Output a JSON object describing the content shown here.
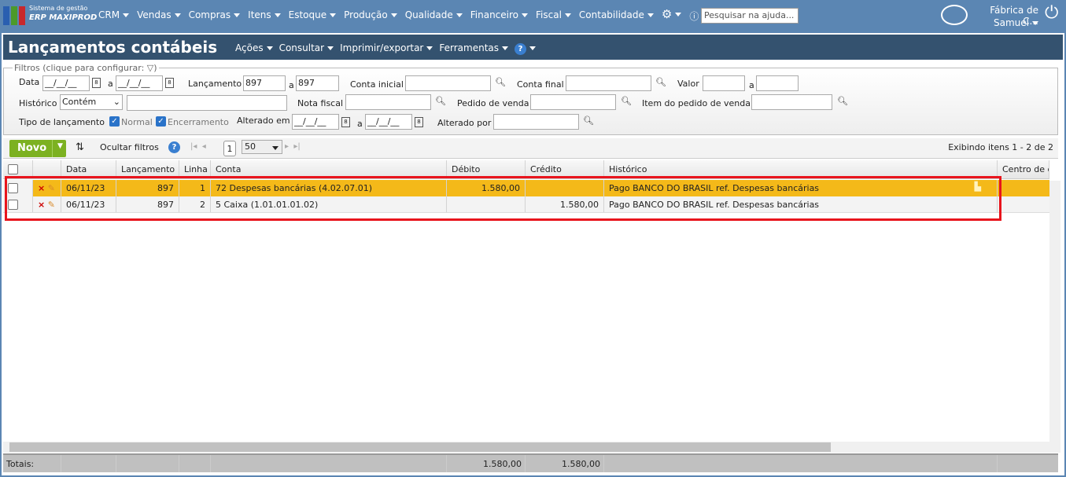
{
  "topbar": {
    "brand_line1": "Sistema de gestão",
    "brand_line2": "ERP MAXIPROD",
    "menu": [
      "CRM",
      "Vendas",
      "Compras",
      "Itens",
      "Estoque",
      "Produção",
      "Qualidade",
      "Financeiro",
      "Fiscal",
      "Contabilidade"
    ],
    "search_placeholder": "Pesquisar na ajuda...",
    "company": "Fábrica de C...",
    "user": "Samuel"
  },
  "page": {
    "title": "Lançamentos contábeis",
    "menu": [
      "Ações",
      "Consultar",
      "Imprimir/exportar",
      "Ferramentas"
    ]
  },
  "filters": {
    "legend": "Filtros (clique para configurar:",
    "legend_end": ")",
    "data_label": "Data",
    "date_placeholder": "__/__/__",
    "a": "a",
    "lancamento_label": "Lançamento",
    "lancamento_from": "897",
    "lancamento_to": "897",
    "conta_inicial_label": "Conta inicial",
    "conta_final_label": "Conta final",
    "valor_label": "Valor",
    "historico_label": "Histórico",
    "historico_op": "Contém",
    "nota_fiscal_label": "Nota fiscal",
    "pedido_label": "Pedido de venda",
    "item_pedido_label": "Item do pedido de venda",
    "tipo_label": "Tipo de lançamento",
    "normal": "Normal",
    "encerramento": "Encerramento",
    "alterado_em_label": "Alterado em",
    "alterado_por_label": "Alterado por"
  },
  "toolbar": {
    "novo": "Novo",
    "ocultar": "Ocultar filtros",
    "page": "1",
    "page_size": "50",
    "showing": "Exibindo itens 1 - 2 de 2"
  },
  "grid": {
    "columns": [
      "Data",
      "Lançamento",
      "Linha",
      "Conta",
      "Débito",
      "Crédito",
      "Histórico",
      "Centro de c"
    ],
    "rows": [
      {
        "data": "06/11/23",
        "lancamento": "897",
        "linha": "1",
        "conta": "72 Despesas bancárias (4.02.07.01)",
        "debito": "1.580,00",
        "credito": "",
        "historico": "Pago BANCO DO BRASIL ref. Despesas bancárias"
      },
      {
        "data": "06/11/23",
        "lancamento": "897",
        "linha": "2",
        "conta": "5 Caixa (1.01.01.01.02)",
        "debito": "",
        "credito": "1.580,00",
        "historico": "Pago BANCO DO BRASIL ref. Despesas bancárias"
      }
    ],
    "totals": {
      "label": "Totais:",
      "debito": "1.580,00",
      "credito": "1.580,00"
    }
  },
  "colors": {
    "topbar": "#5b86b3",
    "titlebar": "#34526f",
    "selected_row": "#f4b919",
    "novo": "#7cb121",
    "highlight": "#e8141c"
  }
}
